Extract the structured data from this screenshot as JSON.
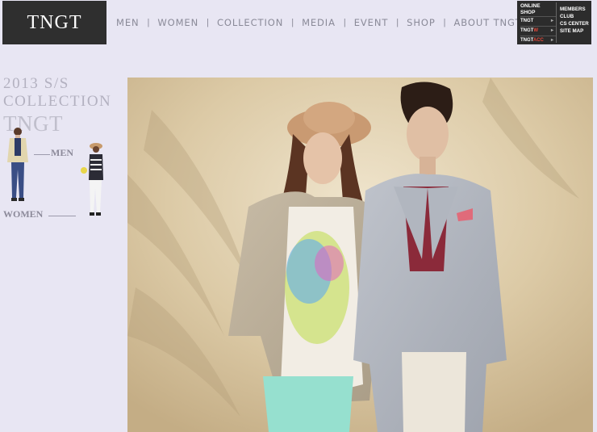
{
  "brand": {
    "logo": "TNGT"
  },
  "nav": {
    "items": [
      "MEN",
      "WOMEN",
      "COLLECTION",
      "MEDIA",
      "EVENT",
      "SHOP",
      "ABOUT TNGT"
    ],
    "separator": "|"
  },
  "util": {
    "online_shop_line1": "ONLINE",
    "online_shop_line2": "SHOP",
    "shops": [
      {
        "base": "TNGT",
        "suffix": ""
      },
      {
        "base": "TNGT",
        "suffix": "W"
      },
      {
        "base": "TNGT",
        "suffix": "ACC"
      }
    ],
    "links": [
      "MEMBERS",
      "CLUB",
      "CS CENTER",
      "SITE MAP"
    ]
  },
  "collection": {
    "year": "2013 S/S",
    "label": "COLLECTION",
    "brand": "TNGT"
  },
  "side": {
    "men_label": "MEN",
    "women_label": "WOMEN"
  },
  "colors": {
    "background": "#e8e6f3",
    "logo_bg": "#2f2f2f",
    "accent": "#e2483a"
  },
  "hero": {
    "alt": "2013 S/S couple"
  }
}
